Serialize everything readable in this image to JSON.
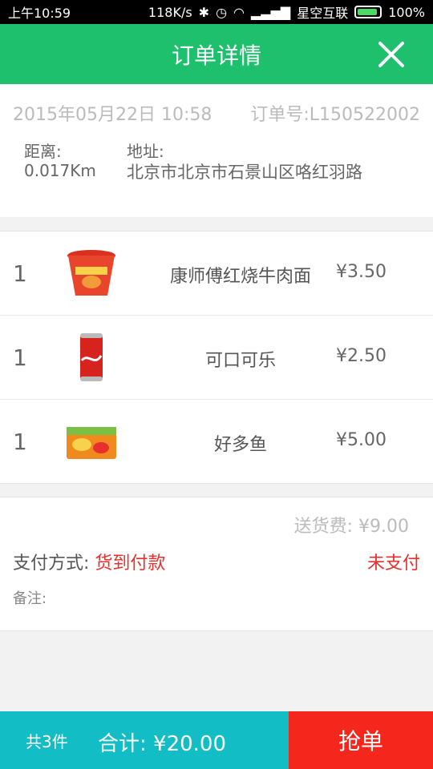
{
  "status_bar": {
    "time": "上午10:59",
    "speed": "118K/s",
    "carrier": "星空互联",
    "battery": "100%"
  },
  "header": {
    "title": "订单详情"
  },
  "order": {
    "date": "2015年05月22日 10:58",
    "order_no": "订单号:L150522002",
    "distance_label": "距离:",
    "distance_value": "0.017Km",
    "address_label": "地址:",
    "address_value": "北京市北京市石景山区咯红羽路"
  },
  "items": [
    {
      "qty": "1",
      "name": "康师傅红烧牛肉面",
      "price": "¥3.50",
      "icon": "noodle-cup-icon"
    },
    {
      "qty": "1",
      "name": "可口可乐",
      "price": "¥2.50",
      "icon": "cola-can-icon"
    },
    {
      "qty": "1",
      "name": "好多鱼",
      "price": "¥5.00",
      "icon": "snack-box-icon"
    }
  ],
  "payment": {
    "delivery_fee": "送货费: ¥9.00",
    "method_label": "支付方式: ",
    "method_value": "货到付款",
    "status": "未支付",
    "note_label": "备注:"
  },
  "footer": {
    "count": "共3件",
    "total": "合计: ¥20.00",
    "grab_button": "抢单"
  },
  "colors": {
    "header_green": "#1ec06d",
    "footer_teal": "#12bdc5",
    "grab_red": "#f5271c",
    "accent_red": "#e5302d"
  }
}
